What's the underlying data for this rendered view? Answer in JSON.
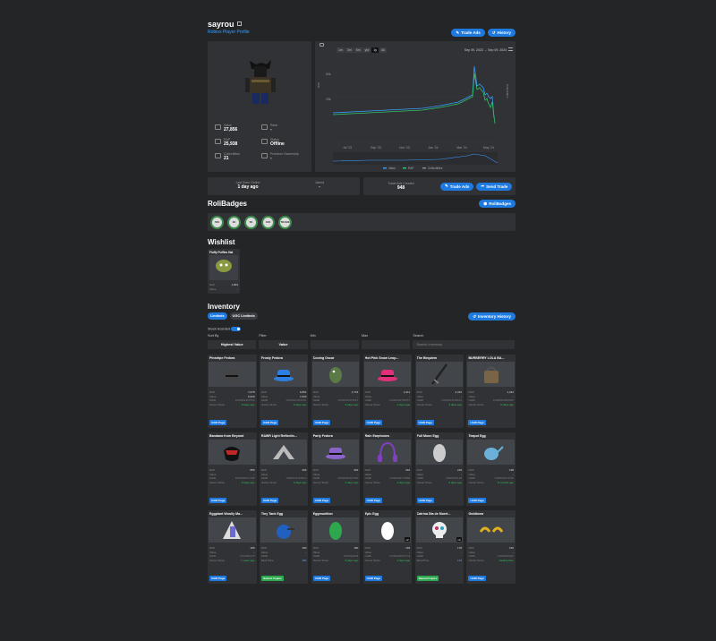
{
  "profile": {
    "username": "sayrou",
    "subtitle": "Roblox Player Profile",
    "trade_ads_label": "Trade Ads",
    "history_label": "History"
  },
  "stats": [
    {
      "label": "Value",
      "value": "27,856"
    },
    {
      "label": "Rank",
      "value": "-"
    },
    {
      "label": "RAP",
      "value": "25,938"
    },
    {
      "label": "Status",
      "value": "Offline"
    },
    {
      "label": "Collectibles",
      "value": "21"
    },
    {
      "label": "Premium Ownership",
      "value": "-"
    }
  ],
  "chart": {
    "ranges": [
      "1m",
      "3m",
      "6m",
      "1y",
      "ytd",
      "All"
    ],
    "active_range": "1y",
    "date_from": "Sep 09, 2023",
    "date_to": "Sep 09, 2024",
    "x_ticks": [
      "Jul '23",
      "Sep '23",
      "Nov '23",
      "Jan '24",
      "Mar '24",
      "May '24"
    ],
    "y_ticks": [
      "50k",
      "25k"
    ],
    "y_right_label": "Collectibles",
    "legend": [
      "Value",
      "RAP",
      "Collectibles"
    ],
    "colors": {
      "value": "#3a9cff",
      "rap": "#2ec46a",
      "grid": "#3d4045"
    }
  },
  "info": {
    "last_seen_label": "Last Seen Online",
    "last_seen_value": "1 day ago",
    "joined_label": "Joined",
    "joined_value": "-",
    "trade_ads_created_label": "Trade Ads Created",
    "trade_ads_created_value": "948",
    "trade_ads_btn": "Trade Ads",
    "send_trade_btn": "Send Trade"
  },
  "rolibadges": {
    "title": "RoliBadges",
    "button": "RoliBadges",
    "badges": [
      "500",
      "1K",
      "5K",
      "10K",
      "TRADE"
    ]
  },
  "wishlist": {
    "title": "Wishlist",
    "items": [
      {
        "name": "Fluffy Puffles Hat",
        "rap_label": "RAP",
        "rap": "1,893",
        "value_label": "Value",
        "value": "-"
      }
    ]
  },
  "inventory": {
    "title": "Inventory",
    "tabs": [
      "Limiteds",
      "UGC Limiteds"
    ],
    "history_button": "Inventory History",
    "stock_label": "Stock Hoarded",
    "filters": {
      "sort_by_label": "Sort By",
      "sort_by_value": "Highest Value",
      "filter_label": "Filter",
      "filter_value": "Value",
      "min_label": "Min",
      "max_label": "Max",
      "search_label": "Search",
      "search_placeholder": "Search Inventory"
    },
    "row_labels": {
      "rap": "RAP",
      "value": "Value",
      "uaid": "UAID",
      "owner_since": "Owner Since",
      "best_price": "Best Price"
    },
    "uaid_button": "UAID Page",
    "dup_button": "Owned Copies",
    "items": [
      {
        "name": "Pinstripe Fedora",
        "rap": "7,078",
        "value": "6,000",
        "uaid": "4926863352790",
        "since": "5 days ago",
        "icon": "fedora",
        "tint": "#444"
      },
      {
        "name": "Frosty Fedora",
        "rap": "6,854",
        "value": "7,000",
        "uaid": "11932957261351",
        "since": "3 days ago",
        "icon": "fedora",
        "tint": "#2e7ee0"
      },
      {
        "name": "Cooing Oscar",
        "rap": "2,734",
        "value": "-",
        "uaid": "11584483379417",
        "since": "4 days ago",
        "icon": "bird",
        "tint": "#5a7a46"
      },
      {
        "name": "Hot Pink Snow Leop...",
        "rap": "2,411",
        "value": "-",
        "uaid": "11684482750057",
        "since": "4 days ago",
        "icon": "fedora",
        "tint": "#e0307a"
      },
      {
        "name": "The Bequiem",
        "rap": "2,342",
        "value": "-",
        "uaid": "11664813156243",
        "since": "4 days ago",
        "icon": "sword",
        "tint": "#222"
      },
      {
        "name": "BURBERRY LOLA BA...",
        "rap": "1,344",
        "value": "-",
        "uaid": "14080993982950",
        "since": "5 days ago",
        "icon": "bag",
        "tint": "#7a6446"
      },
      {
        "name": "Bandana from Beyond",
        "rap": "885",
        "value": "-",
        "uaid": "4803580217786",
        "since": "5 days ago",
        "icon": "mask",
        "tint": "#c02828"
      },
      {
        "name": "RAWR Light Reflectin...",
        "rap": "396",
        "value": "-",
        "uaid": "10862541101815",
        "since": "3 days ago",
        "icon": "wings",
        "tint": "#bbb"
      },
      {
        "name": "Party Fedora",
        "rap": "352",
        "value": "-",
        "uaid": "11584480827850",
        "since": "4 days ago",
        "icon": "fedora",
        "tint": "#8a64c8"
      },
      {
        "name": "Rain Earphones",
        "rap": "316",
        "value": "-",
        "uaid": "11684482770860",
        "since": "4 days ago",
        "icon": "phones",
        "tint": "#8040c0"
      },
      {
        "name": "Full Moon Egg",
        "rap": "203",
        "value": "-",
        "uaid": "13829032128",
        "since": "3 days ago",
        "icon": "egg",
        "tint": "#ccc"
      },
      {
        "name": "Teapot Egg",
        "rap": "198",
        "value": "-",
        "uaid": "7038016271768",
        "since": "5 months ago",
        "icon": "teapot",
        "tint": "#6ab0d8"
      },
      {
        "name": "Eggplant Woolly Ma...",
        "rap": "185",
        "value": "-",
        "uaid": "2702831178",
        "since": "7 years ago",
        "icon": "mammoth",
        "tint": "#6a6ad0",
        "qty": ""
      },
      {
        "name": "Tiny Tank Egg",
        "rap": "180",
        "value": "-",
        "uaid": "",
        "best": "178",
        "since_label": "Best Price",
        "since": "180",
        "icon": "tank",
        "tint": "#2060c0",
        "dup": true
      },
      {
        "name": "Eggmunition",
        "rap": "180",
        "value": "-",
        "uaid": "7087361848",
        "since": "5 days ago",
        "icon": "egg",
        "tint": "#2ea84f"
      },
      {
        "name": "Epic Egg",
        "rap": "184",
        "value": "-",
        "uaid": "11584482667743",
        "since": "4 days ago",
        "icon": "egg",
        "tint": "#fff",
        "qty": "x2"
      },
      {
        "name": "Catrina Dia de Muert...",
        "rap": "178",
        "value": "-",
        "uaid": "",
        "best": "124",
        "since_label": "Best Price",
        "since": "124",
        "icon": "skull",
        "tint": "#eee",
        "qty": "x3",
        "dup": true
      },
      {
        "name": "Goldbrow",
        "rap": "160",
        "value": "-",
        "uaid": "14095830046",
        "since": "loading time",
        "icon": "brow",
        "tint": "#e0b020"
      }
    ]
  }
}
